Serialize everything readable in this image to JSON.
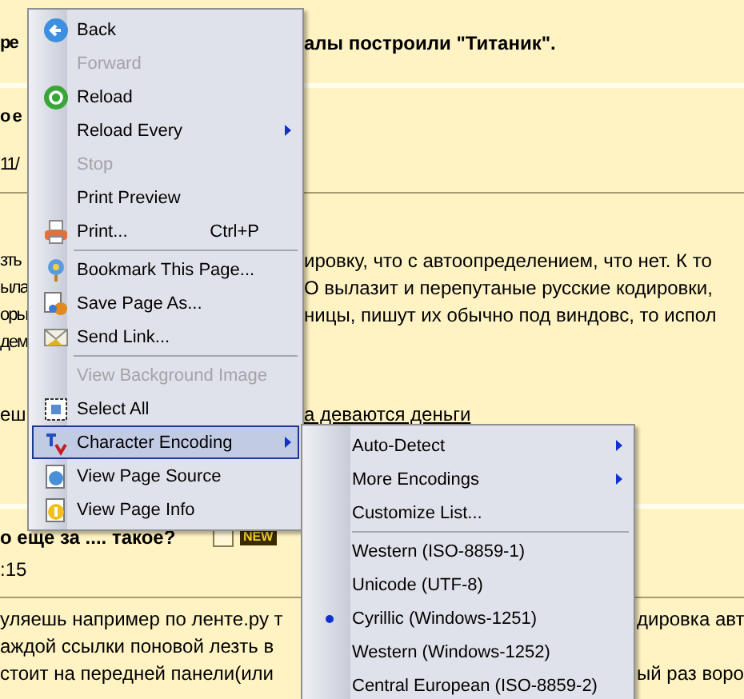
{
  "page": {
    "rows": [
      {
        "kind": "heading",
        "left": "ре",
        "right": "алы построили \"Титаник\"."
      },
      {
        "kind": "heading",
        "left": "о е"
      },
      {
        "kind": "meta",
        "left": "11/"
      },
      {
        "kind": "text",
        "left": "зть",
        "right": "ировку, что с автоопределением, что нет. К то"
      },
      {
        "kind": "text",
        "left": "ыла",
        "right": "O вылазит и перепутаные русские кодировки,"
      },
      {
        "kind": "text",
        "left": "оры",
        "right": "ницы, пишут их обычно под виндовс, то испол"
      },
      {
        "kind": "text",
        "left": "дем"
      },
      {
        "kind": "link",
        "left": "еш",
        "right": "а деваются деньги"
      },
      {
        "kind": "heading",
        "left": "о еще за .... такое?",
        "badge": "NEW"
      },
      {
        "kind": "meta",
        "left": ":15"
      },
      {
        "kind": "text",
        "left": "уляешь например по ленте.ру т",
        "right": "дировка авт"
      },
      {
        "kind": "text",
        "left": "аждой ссылки поновой лезть в"
      },
      {
        "kind": "text",
        "left": "стоит на передней панели(или",
        "right": "ый раз воро"
      }
    ]
  },
  "context_menu": {
    "items": [
      {
        "kind": "item",
        "label": "Back",
        "icon": true,
        "disabled": false,
        "submenu": false,
        "highlighted": false
      },
      {
        "kind": "item",
        "label": "Forward",
        "icon": false,
        "disabled": true,
        "submenu": false,
        "highlighted": false
      },
      {
        "kind": "item",
        "label": "Reload",
        "icon": true,
        "disabled": false,
        "submenu": false,
        "highlighted": false
      },
      {
        "kind": "item",
        "label": "Reload Every",
        "icon": false,
        "disabled": false,
        "submenu": true,
        "highlighted": false
      },
      {
        "kind": "item",
        "label": "Stop",
        "icon": false,
        "disabled": true,
        "submenu": false,
        "highlighted": false
      },
      {
        "kind": "item",
        "label": "Print Preview",
        "icon": false,
        "disabled": false,
        "submenu": false,
        "highlighted": false
      },
      {
        "kind": "item",
        "label": "Print...",
        "icon": true,
        "disabled": false,
        "submenu": false,
        "highlighted": false,
        "shortcut": "Ctrl+P"
      },
      {
        "kind": "separator"
      },
      {
        "kind": "item",
        "label": "Bookmark This Page...",
        "icon": true,
        "disabled": false,
        "submenu": false,
        "highlighted": false
      },
      {
        "kind": "item",
        "label": "Save Page As...",
        "icon": true,
        "disabled": false,
        "submenu": false,
        "highlighted": false
      },
      {
        "kind": "item",
        "label": "Send Link...",
        "icon": true,
        "disabled": false,
        "submenu": false,
        "highlighted": false
      },
      {
        "kind": "separator"
      },
      {
        "kind": "item",
        "label": "View Background Image",
        "icon": false,
        "disabled": true,
        "submenu": false,
        "highlighted": false
      },
      {
        "kind": "item",
        "label": "Select All",
        "icon": true,
        "disabled": false,
        "submenu": false,
        "highlighted": false
      },
      {
        "kind": "item",
        "label": "Character Encoding",
        "icon": true,
        "disabled": false,
        "submenu": true,
        "highlighted": true
      },
      {
        "kind": "item",
        "label": "View Page Source",
        "icon": true,
        "disabled": false,
        "submenu": false,
        "highlighted": false
      },
      {
        "kind": "item",
        "label": "View Page Info",
        "icon": true,
        "disabled": false,
        "submenu": false,
        "highlighted": false
      }
    ]
  },
  "encoding_submenu": {
    "items": [
      {
        "kind": "command",
        "label": "Auto-Detect",
        "submenu": true
      },
      {
        "kind": "command",
        "label": "More Encodings",
        "submenu": true
      },
      {
        "kind": "command",
        "label": "Customize List...",
        "submenu": false
      },
      {
        "kind": "separator"
      },
      {
        "kind": "encoding",
        "label": "Western (ISO-8859-1)",
        "selected": false
      },
      {
        "kind": "encoding",
        "label": "Unicode (UTF-8)",
        "selected": false
      },
      {
        "kind": "encoding",
        "label": "Cyrillic (Windows-1251)",
        "selected": true
      },
      {
        "kind": "encoding",
        "label": "Western (Windows-1252)",
        "selected": false
      },
      {
        "kind": "encoding",
        "label": "Central European (ISO-8859-2)",
        "selected": false
      }
    ]
  }
}
